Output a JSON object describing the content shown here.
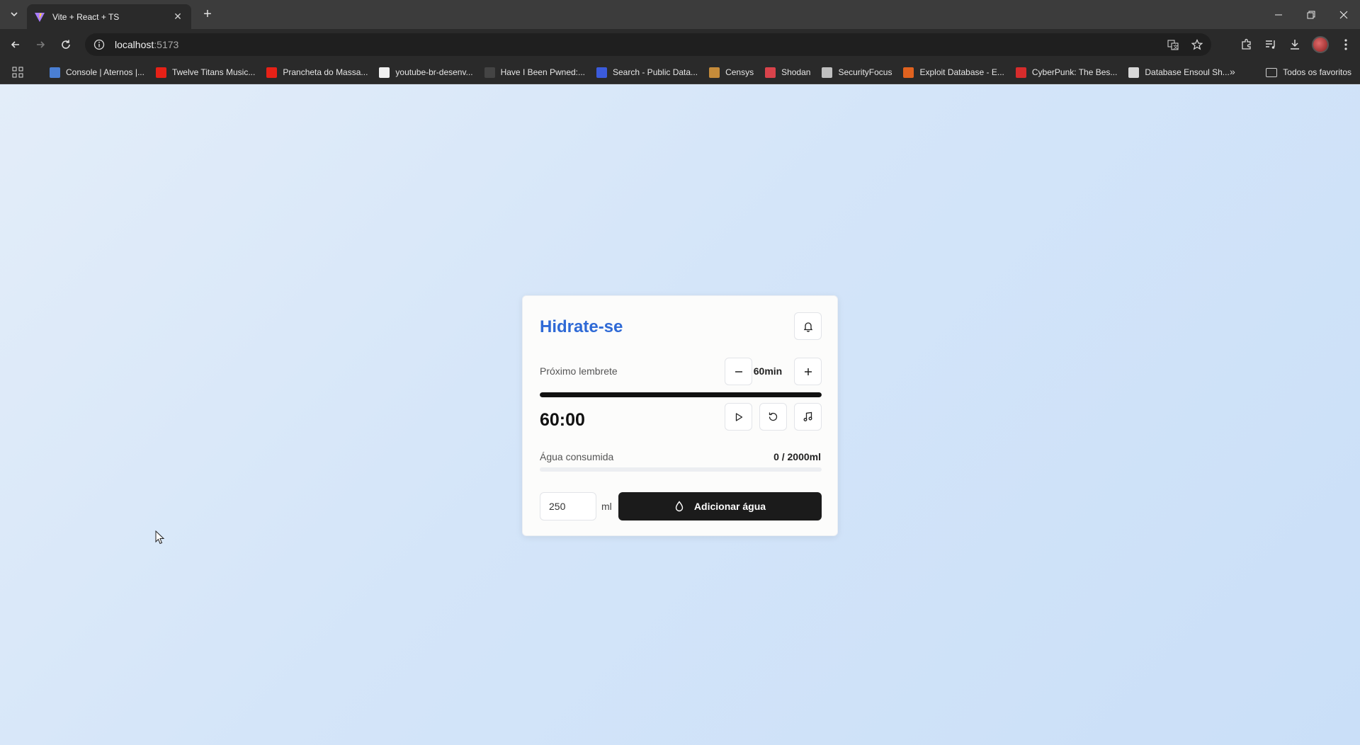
{
  "browser": {
    "tab_title": "Vite + React + TS",
    "new_tab_label": "+",
    "url_host": "localhost",
    "url_rest": ":5173",
    "bookmarks": [
      {
        "label": "Console | Aternos |...",
        "color": "#4a7fd4"
      },
      {
        "label": "Twelve Titans Music...",
        "color": "#e62117"
      },
      {
        "label": "Prancheta do Massa...",
        "color": "#e62117"
      },
      {
        "label": "youtube-br-desenv...",
        "color": "#f0f0f0"
      },
      {
        "label": "Have I Been Pwned:...",
        "color": "#444444"
      },
      {
        "label": "Search - Public Data...",
        "color": "#3b5bdb"
      },
      {
        "label": "Censys",
        "color": "#c58b3a"
      },
      {
        "label": "Shodan",
        "color": "#d9434b"
      },
      {
        "label": "SecurityFocus",
        "color": "#bfbfbf"
      },
      {
        "label": "Exploit Database - E...",
        "color": "#e0621f"
      },
      {
        "label": "CyberPunk: The Bes...",
        "color": "#d62c2c"
      },
      {
        "label": "Database Ensoul Sh...",
        "color": "#d8d8d8"
      }
    ],
    "more_label": "»",
    "all_bookmarks_label": "Todos os favoritos"
  },
  "app": {
    "title": "Hidrate-se",
    "reminder_label": "Próximo lembrete",
    "interval_value": "60min",
    "timer_progress_percent": 100,
    "timer": "60:00",
    "water_label": "Água consumida",
    "water_value": "0 / 2000ml",
    "water_progress_percent": 0,
    "amount_input_value": "250",
    "unit_label": "ml",
    "add_button_label": "Adicionar água",
    "accent_color": "#2f6ad6"
  }
}
